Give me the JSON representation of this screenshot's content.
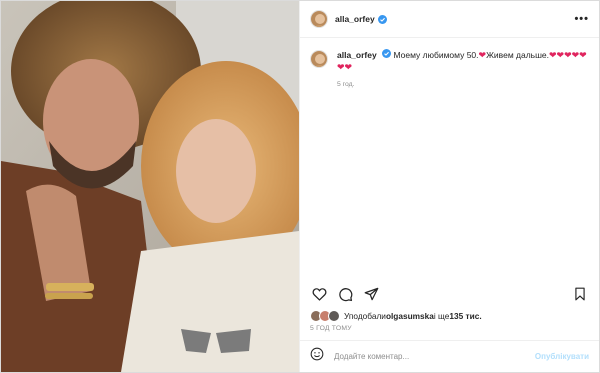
{
  "post": {
    "username": "alla_orfey",
    "caption_text": "Моему любимому 50.",
    "caption_text2": "Живем дальше.",
    "caption_hearts_line1": "❤❤❤❤❤",
    "caption_hearts_line2": "❤❤",
    "caption_time": "5 год.",
    "likes_prefix": "Уподобали ",
    "likes_user": "olgasumska",
    "likes_suffix": " і ще ",
    "likes_count": "135 тис.",
    "post_time": "5 ГОД ТОМУ",
    "comment_placeholder": "Додайте коментар...",
    "publish_label": "Опублікувати",
    "more_label": "•••"
  },
  "colors": {
    "heart": "#e0245e",
    "verified": "#3897f0",
    "publish": "#b2dffc"
  },
  "icons": [
    "verified-icon",
    "more-icon",
    "heart-icon",
    "comment-icon",
    "share-icon",
    "bookmark-icon",
    "emoji-icon"
  ]
}
